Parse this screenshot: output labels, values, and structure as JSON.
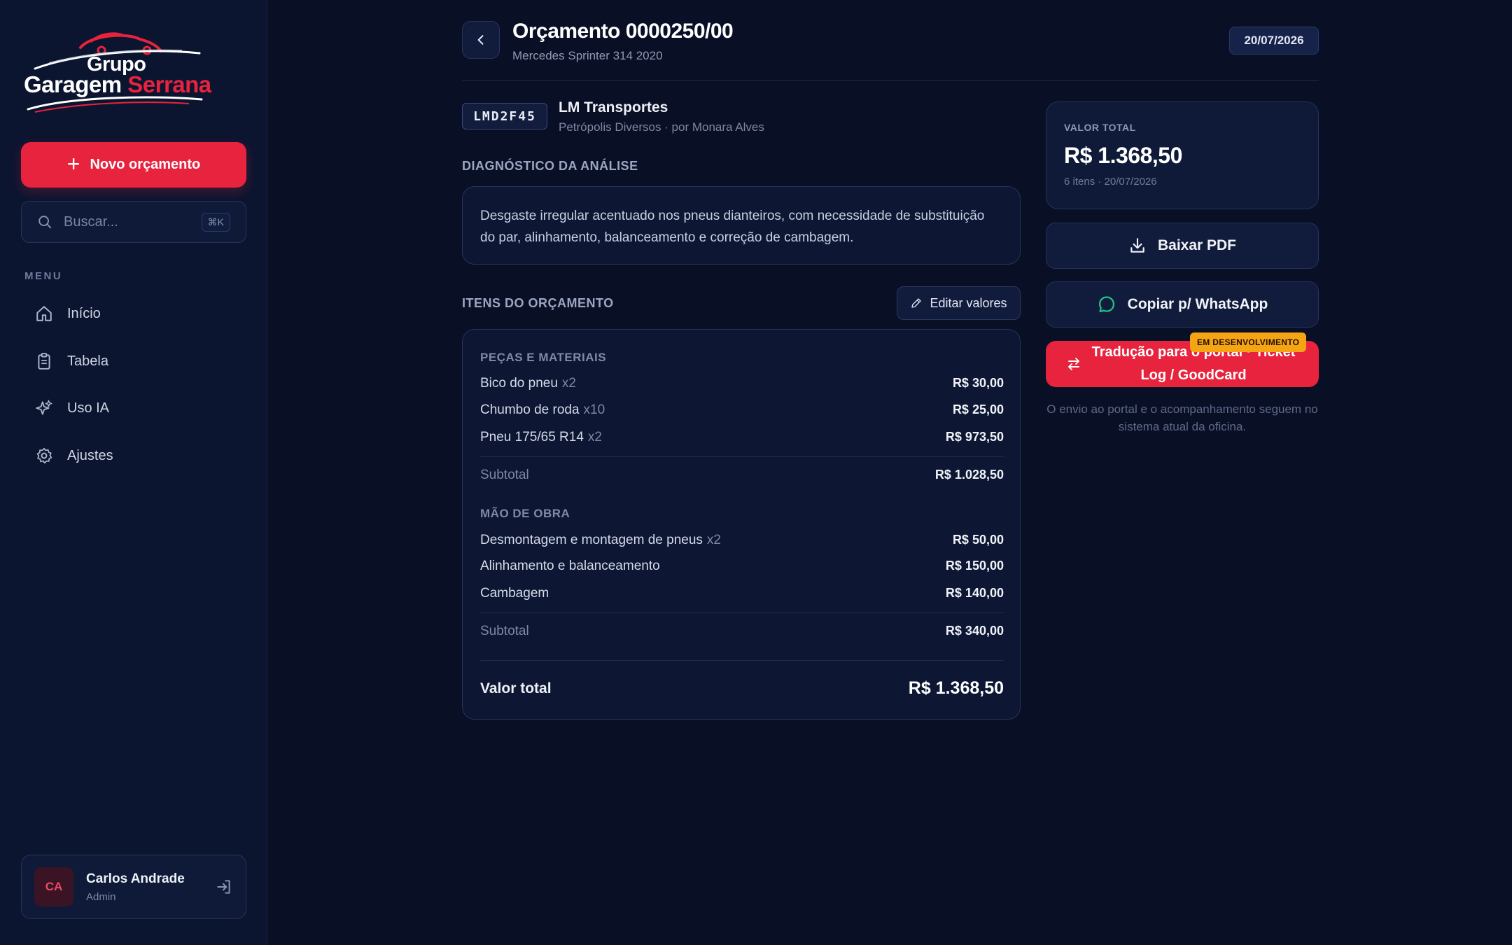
{
  "brand": {
    "line1": "Grupo",
    "line2_white": "Garagem ",
    "line2_red": "Serrana"
  },
  "sidebar": {
    "new_button": "Novo orçamento",
    "search_placeholder": "Buscar...",
    "search_shortcut": "⌘K",
    "menu_label": "MENU",
    "items": [
      {
        "label": "Início",
        "icon": "home-icon"
      },
      {
        "label": "Tabela",
        "icon": "clipboard-icon"
      },
      {
        "label": "Uso IA",
        "icon": "sparkles-icon"
      },
      {
        "label": "Ajustes",
        "icon": "gear-icon"
      }
    ],
    "user": {
      "initials": "CA",
      "name": "Carlos Andrade",
      "role": "Admin"
    }
  },
  "header": {
    "title": "Orçamento 0000250/00",
    "subtitle": "Mercedes Sprinter 314 2020",
    "date": "20/07/2026"
  },
  "client": {
    "plate": "LMD2F45",
    "name": "LM Transportes",
    "detail": "Petrópolis Diversos · por Monara Alves"
  },
  "diagnosis": {
    "title": "DIAGNÓSTICO DA ANÁLISE",
    "text": "Desgaste irregular acentuado nos pneus dianteiros, com necessidade de substituição do par, alinhamento, balanceamento e correção de cambagem."
  },
  "items": {
    "title": "ITENS DO ORÇAMENTO",
    "edit_button": "Editar valores",
    "parts": {
      "title": "PEÇAS E MATERIAIS",
      "rows": [
        {
          "name": "Bico do pneu",
          "qty": "x2",
          "price": "R$ 30,00"
        },
        {
          "name": "Chumbo de roda",
          "qty": "x10",
          "price": "R$ 25,00"
        },
        {
          "name": "Pneu 175/65 R14",
          "qty": "x2",
          "price": "R$ 973,50"
        }
      ],
      "subtotal_label": "Subtotal",
      "subtotal": "R$ 1.028,50"
    },
    "labor": {
      "title": "MÃO DE OBRA",
      "rows": [
        {
          "name": "Desmontagem e montagem de pneus",
          "qty": "x2",
          "price": "R$ 50,00"
        },
        {
          "name": "Alinhamento e balanceamento",
          "qty": "",
          "price": "R$ 150,00"
        },
        {
          "name": "Cambagem",
          "qty": "",
          "price": "R$ 140,00"
        }
      ],
      "subtotal_label": "Subtotal",
      "subtotal": "R$ 340,00"
    },
    "total_label": "Valor total",
    "total": "R$ 1.368,50"
  },
  "summary": {
    "label": "VALOR TOTAL",
    "value": "R$ 1.368,50",
    "meta": "6 itens · 20/07/2026",
    "pdf_button": "Baixar PDF",
    "whatsapp_button": "Copiar p/ WhatsApp",
    "translate_line1": "Tradução para o portal · Ticket",
    "translate_line2": "Log / GoodCard",
    "dev_badge": "EM DESENVOLVIMENTO",
    "note": "O envio ao portal e o acompanhamento seguem no sistema atual da oficina."
  },
  "colors": {
    "accent": "#e8233d",
    "badge": "#f5a414",
    "background": "#090f24",
    "whatsapp": "#22c58b"
  }
}
